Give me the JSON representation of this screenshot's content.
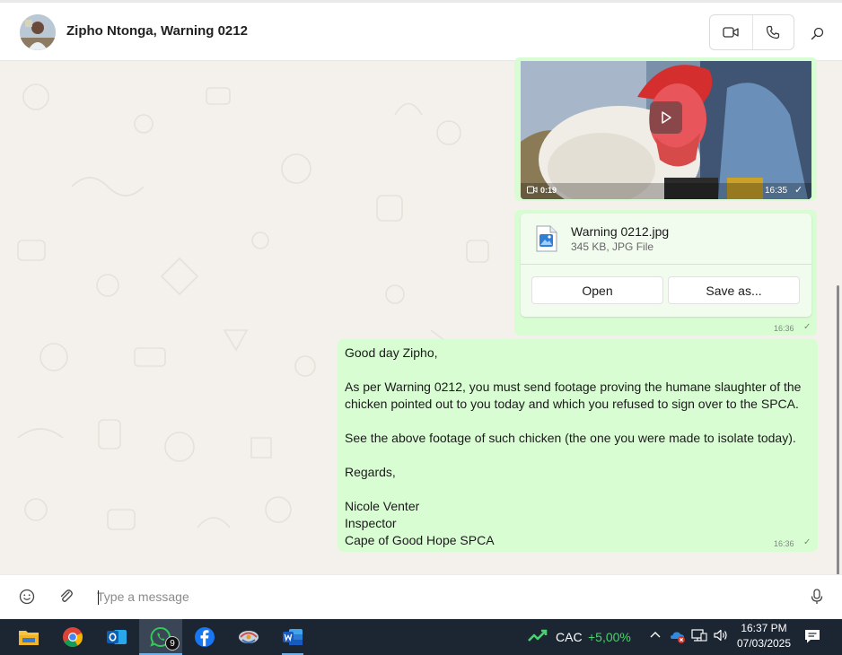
{
  "header": {
    "title": "Zipho Ntonga, Warning 0212",
    "icons": [
      "video-camera-icon",
      "phone-icon",
      "search-icon"
    ]
  },
  "video_message": {
    "duration": "0:19",
    "time": "16:35",
    "status": "✓"
  },
  "file_message": {
    "file_name": "Warning 0212.jpg",
    "file_meta": "345 KB, JPG File",
    "open_label": "Open",
    "save_label": "Save as...",
    "time": "16:36",
    "status": "✓"
  },
  "text_message": {
    "lines": [
      "Good day Zipho,",
      "As per Warning 0212, you must send footage proving the humane slaughter of the",
      "chicken pointed out to you today and which you refused to sign over to the SPCA.",
      "See the above footage of such chicken (the one you were made to isolate today).",
      "Regards,",
      "Nicole Venter",
      "Inspector",
      "Cape of Good Hope SPCA"
    ],
    "time": "16:36",
    "status": "✓"
  },
  "composer": {
    "placeholder": "Type a message",
    "value": ""
  },
  "taskbar": {
    "apps": [
      "file-explorer-icon",
      "chrome-icon",
      "outlook-icon",
      "whatsapp-icon",
      "facebook-icon",
      "app-icon",
      "word-icon"
    ],
    "whatsapp_badge": "9",
    "stock_name": "CAC",
    "stock_change": "+5,00%",
    "time": "16:37 PM",
    "date": "07/03/2025"
  },
  "colors": {
    "bubble": "#d9fdd3",
    "chat_background": "#f4f1ec",
    "taskbar": "#1c2633",
    "stock_green": "#48d36a"
  }
}
